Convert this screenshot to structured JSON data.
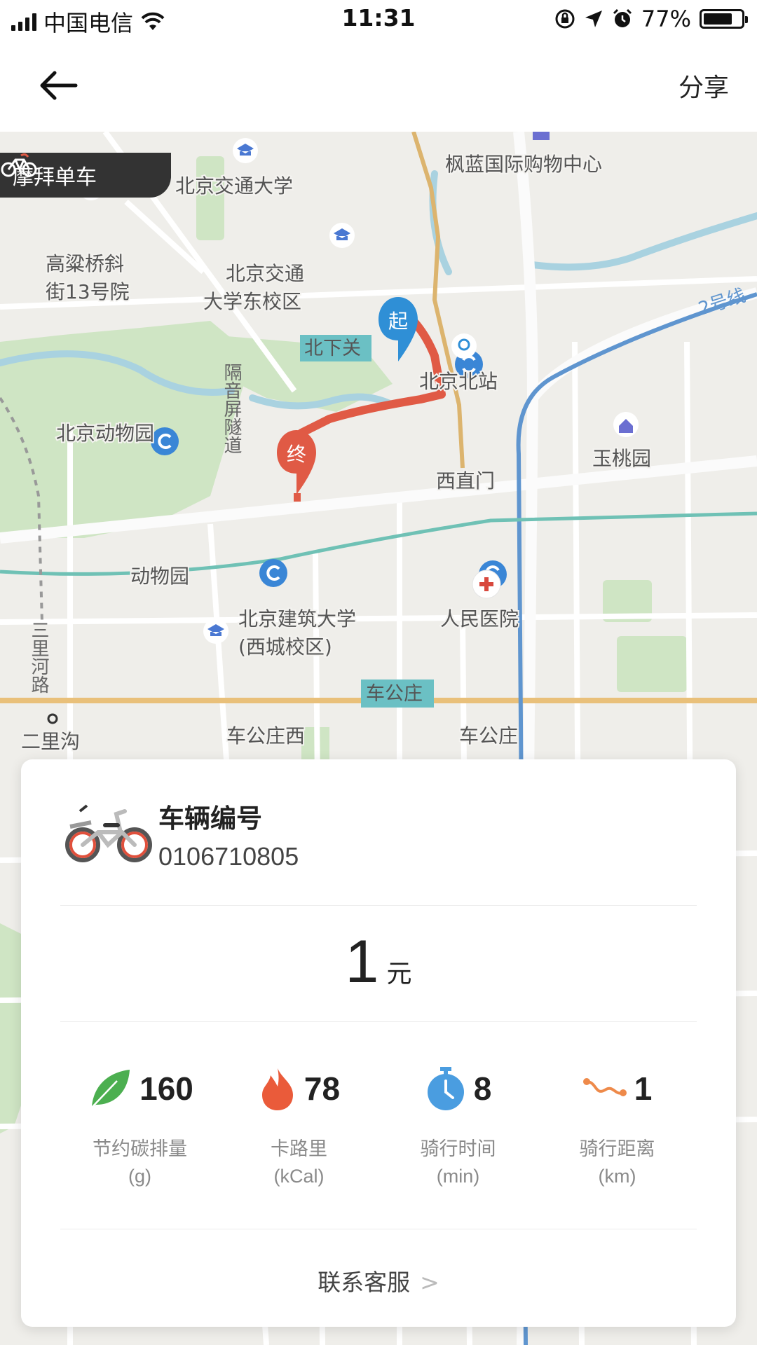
{
  "status_bar": {
    "carrier": "中国电信",
    "time": "11:31",
    "battery": "77%",
    "battery_level": 0.77
  },
  "header": {
    "share_label": "分享"
  },
  "map": {
    "brand": "摩拜单车",
    "start_marker": "起",
    "end_marker": "终",
    "labels": {
      "jiaotong_univ": "北京交通大学",
      "fenglan": "枫蓝国际购物中心",
      "gaoliang_1": "高粱桥斜",
      "gaoliang_2": "街13号院",
      "jiaotong_east_1": "北京交通",
      "jiaotong_east_2": "大学东校区",
      "beixiaguan": "北下关",
      "line2": "2号线",
      "beijing_north": "北京北站",
      "tunnel": "隔音屏隧道",
      "zoo": "北京动物园",
      "yutaoyuan": "玉桃园",
      "xizhimen": "西直门",
      "dongwuyuan": "动物园",
      "renmin": "人民医院",
      "jianzhu_1": "北京建筑大学",
      "jianzhu_2": "(西城校区)",
      "sanlihe": "三里河路",
      "chegongzhuang": "车公庄",
      "chegongzhuang_west": "车公庄西",
      "chegongzhuang_2": "车公庄",
      "erligou": "二里沟"
    }
  },
  "card": {
    "vehicle_title": "车辆编号",
    "vehicle_number": "0106710805",
    "fare_value": "1",
    "fare_unit": "元",
    "stats": [
      {
        "icon": "leaf-icon",
        "value": "160",
        "label": "节约碳排量",
        "unit": "(g)"
      },
      {
        "icon": "flame-icon",
        "value": "78",
        "label": "卡路里",
        "unit": "(kCal)"
      },
      {
        "icon": "stopwatch-icon",
        "value": "8",
        "label": "骑行时间",
        "unit": "(min)"
      },
      {
        "icon": "route-icon",
        "value": "1",
        "label": "骑行距离",
        "unit": "(km)"
      }
    ],
    "contact_label": "联系客服"
  },
  "colors": {
    "route": "#e05a45",
    "start_marker": "#2f8fd6",
    "end_marker": "#e05a45",
    "leaf": "#4caf50",
    "flame": "#ea5b3a",
    "stopwatch": "#4a9de0",
    "route_icon": "#ee8a4a"
  }
}
